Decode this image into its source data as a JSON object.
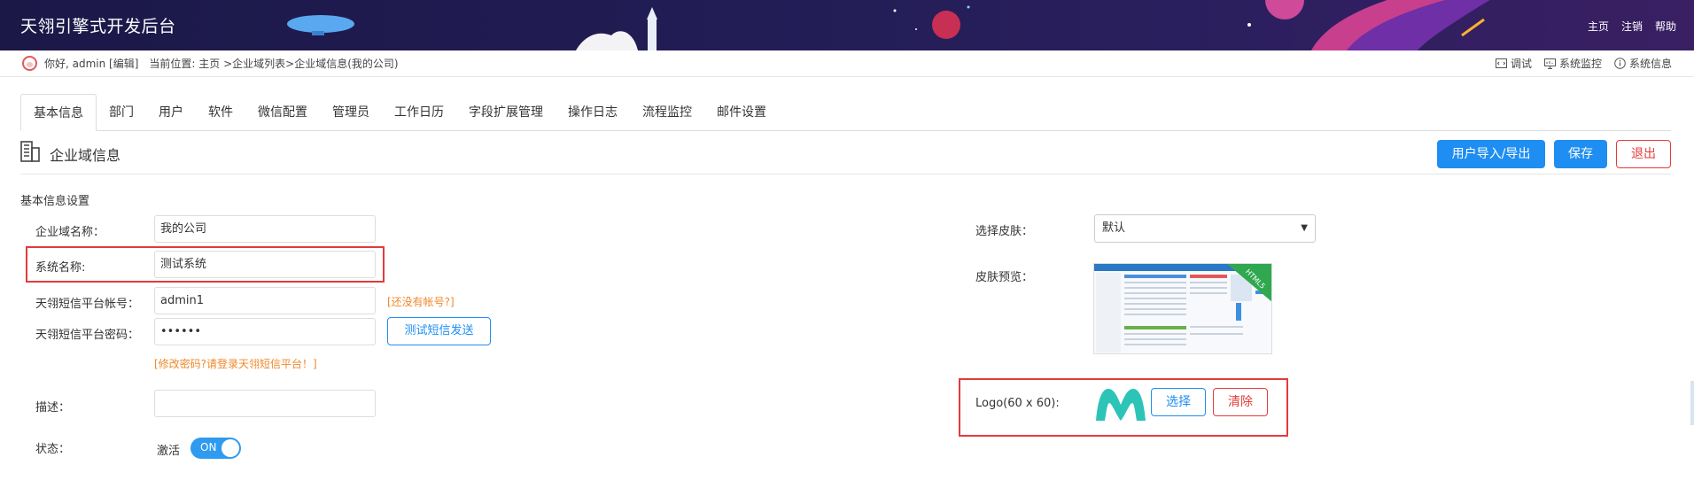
{
  "header": {
    "app_title": "天翎引擎式开发后台",
    "links": [
      "主页",
      "注销",
      "帮助"
    ]
  },
  "userbar": {
    "greeting": "你好, admin [编辑]",
    "location": "当前位置: 主页 >企业域列表>企业域信息(我的公司)",
    "tools": [
      {
        "label": "调试",
        "icon": "code-icon"
      },
      {
        "label": "系统监控",
        "icon": "monitor-icon"
      },
      {
        "label": "系统信息",
        "icon": "info-icon"
      }
    ]
  },
  "tabs": [
    "基本信息",
    "部门",
    "用户",
    "软件",
    "微信配置",
    "管理员",
    "工作日历",
    "字段扩展管理",
    "操作日志",
    "流程监控",
    "邮件设置"
  ],
  "active_tab": "基本信息",
  "section": {
    "title": "企业域信息",
    "buttons": {
      "import_export": "用户导入/导出",
      "save": "保存",
      "exit": "退出"
    }
  },
  "form": {
    "group_title": "基本信息设置",
    "domain_name": {
      "label": "企业域名称：",
      "value": "我的公司"
    },
    "system_name": {
      "label": "系统名称:",
      "value": "测试系统"
    },
    "sms_account": {
      "label": "天翎短信平台帐号：",
      "value": "admin1",
      "hint": "[还没有帐号?]"
    },
    "sms_password": {
      "label": "天翎短信平台密码：",
      "value": "••••••",
      "test_button": "测试短信发送"
    },
    "password_hint": "[修改密码?请登录天翎短信平台！]",
    "description": {
      "label": "描述：",
      "value": ""
    },
    "status": {
      "label": "状态：",
      "state_text": "激活",
      "toggle_text": "ON"
    },
    "skin": {
      "label": "选择皮肤：",
      "value": "默认"
    },
    "skin_preview": {
      "label": "皮肤预览：",
      "badge": "HTML5"
    },
    "logo": {
      "label": "Logo(60 x 60):",
      "select_button": "选择",
      "clear_button": "清除"
    }
  },
  "colors": {
    "primary": "#1e8ef2",
    "danger": "#e63b3b",
    "hint": "#f0882b",
    "header_bg": "#1f1a50",
    "logo_teal": "#2cc4b6"
  }
}
